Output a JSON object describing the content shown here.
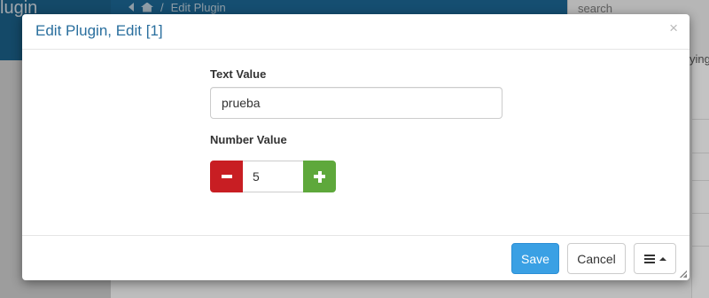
{
  "background": {
    "brand": "lugin",
    "breadcrumb": {
      "current": "Edit Plugin",
      "separator": "/"
    },
    "search_placeholder": "search",
    "column_text": "ying"
  },
  "dialog": {
    "title": "Edit Plugin, Edit [1]",
    "close_symbol": "×",
    "fields": {
      "text_value": {
        "label": "Text Value",
        "value": "prueba"
      },
      "number_value": {
        "label": "Number Value",
        "value": "5"
      }
    },
    "footer": {
      "save_label": "Save",
      "cancel_label": "Cancel"
    }
  },
  "colors": {
    "title": "#2a6f9e",
    "save": "#3aa0e4",
    "decrement": "#c81e23",
    "increment": "#5ea83b",
    "topbar": "#1b6591"
  },
  "icons": [
    "back-arrow-icon",
    "home-icon",
    "close-icon",
    "minus-icon",
    "plus-icon",
    "hamburger-menu-icon",
    "caret-up-icon",
    "resize-grip-icon"
  ]
}
